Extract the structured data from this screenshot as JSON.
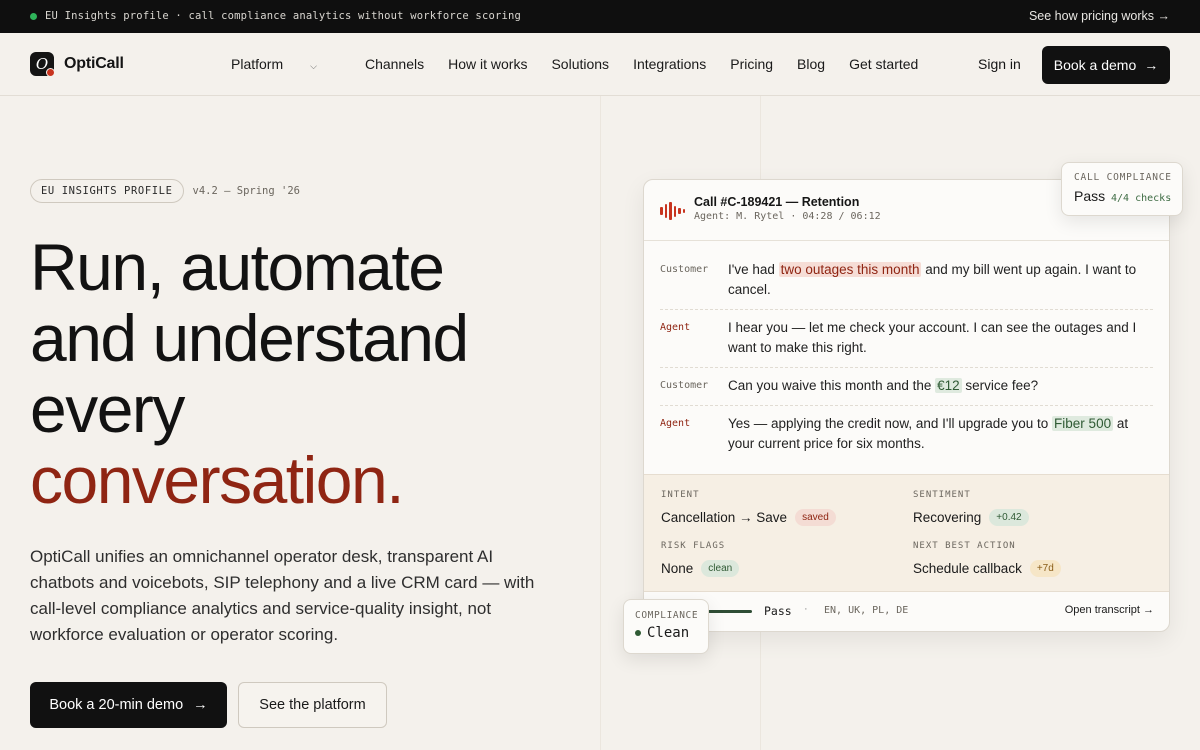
{
  "topbar": {
    "announcement": "EU Insights profile · call compliance analytics without workforce scoring",
    "link": "See how pricing works →",
    "status_color": "#2fb45a"
  },
  "nav": {
    "logo_letter": "O",
    "brand": "OptiCall",
    "items": [
      "Platform",
      "Channels",
      "How it works",
      "Solutions",
      "Integrations",
      "Pricing",
      "Blog",
      "Get started"
    ],
    "dropdown_icon": "chevron-down-icon",
    "sign_in": "Sign in",
    "demo": "Book a demo",
    "arrow": "→"
  },
  "hero": {
    "badge": "EU INSIGHTS PROFILE",
    "version": "v4.2 — Spring '26",
    "headline_lines": [
      "Run, automate",
      "and understand",
      "every"
    ],
    "headline_accent": "conversation.",
    "description": "OptiCall unifies an omnichannel operator desk, transparent AI chatbots and voicebots, SIP telephony and a live CRM card — with call-level compliance analytics and service-quality insight, not workforce evaluation or operator scoring.",
    "cta_primary": "Book a 20-min demo",
    "cta_arrow": "→",
    "cta_secondary": "See the platform",
    "accent_color": "#8f2513"
  },
  "call_card": {
    "title": "Call #C-189421 — Retention",
    "subtitle": "Agent: M. Rytel · 04:28 / 06:12",
    "messages": [
      {
        "speaker": "Customer",
        "before": "I've had ",
        "highlight": "two outages this month",
        "after": " and my bill went up again. I want to cancel.",
        "hl": "red"
      },
      {
        "speaker": "Agent",
        "before": "I hear you — let me check your account. I can see the outages and I want to make this right.",
        "highlight": "",
        "after": "",
        "hl": ""
      },
      {
        "speaker": "Customer",
        "before": "Can you waive this month and the ",
        "highlight": "€12",
        "after": " service fee?",
        "hl": "green"
      },
      {
        "speaker": "Agent",
        "before": "Yes — applying the credit now, and I'll upgrade you to ",
        "highlight": "Fiber 500",
        "after": " at your current price for six months.",
        "hl": "green"
      }
    ],
    "insights": {
      "intent": {
        "label": "INTENT",
        "value": "Cancellation → Save",
        "chip": "saved"
      },
      "sentiment": {
        "label": "SENTIMENT",
        "value": "Recovering",
        "chip": "+0.42"
      },
      "risk": {
        "label": "RISK FLAGS",
        "value": "None",
        "chip": "clean"
      },
      "nba": {
        "label": "NEXT BEST ACTION",
        "value": "Schedule callback",
        "chip": "+7d"
      }
    },
    "footer": {
      "progress": 1.0,
      "status": "Pass",
      "separator": "·",
      "languages": "EN, UK, PL, DE",
      "open_link": "Open transcript →"
    }
  },
  "float_compliance": {
    "label": "CALL COMPLIANCE",
    "value": "Pass",
    "detail": "4/4 checks"
  },
  "float_clean": {
    "label": "COMPLIANCE",
    "value": "Clean"
  }
}
